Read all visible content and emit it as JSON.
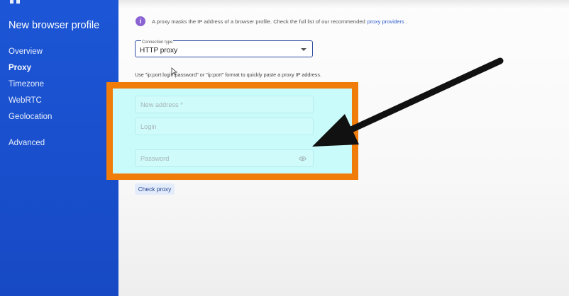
{
  "sidebar": {
    "title": "New browser profile",
    "items": [
      {
        "label": "Overview"
      },
      {
        "label": "Proxy"
      },
      {
        "label": "Timezone"
      },
      {
        "label": "WebRTC"
      },
      {
        "label": "Geolocation"
      },
      {
        "label": "Advanced"
      }
    ],
    "active_item": "Proxy"
  },
  "info": {
    "icon": "info-icon",
    "text": "A proxy masks the IP address of a browser profile. Check the full list of our recommended",
    "link": "proxy providers",
    "suffix": "."
  },
  "connection": {
    "label": "Connection type",
    "value": "HTTP proxy"
  },
  "hint": "Use \"ip:port:login:password\" or \"ip:port\" format to quickly paste a proxy IP address.",
  "fields": {
    "address_placeholder": "New address *",
    "login_placeholder": "Login",
    "password_placeholder": "Password"
  },
  "check_button": "Check proxy",
  "colors": {
    "sidebar": "#1c56d6",
    "highlight_border": "#f07c0a",
    "highlight_fill": "#c9fbfb",
    "info_icon": "#8a63d2",
    "link": "#2a59c9"
  }
}
